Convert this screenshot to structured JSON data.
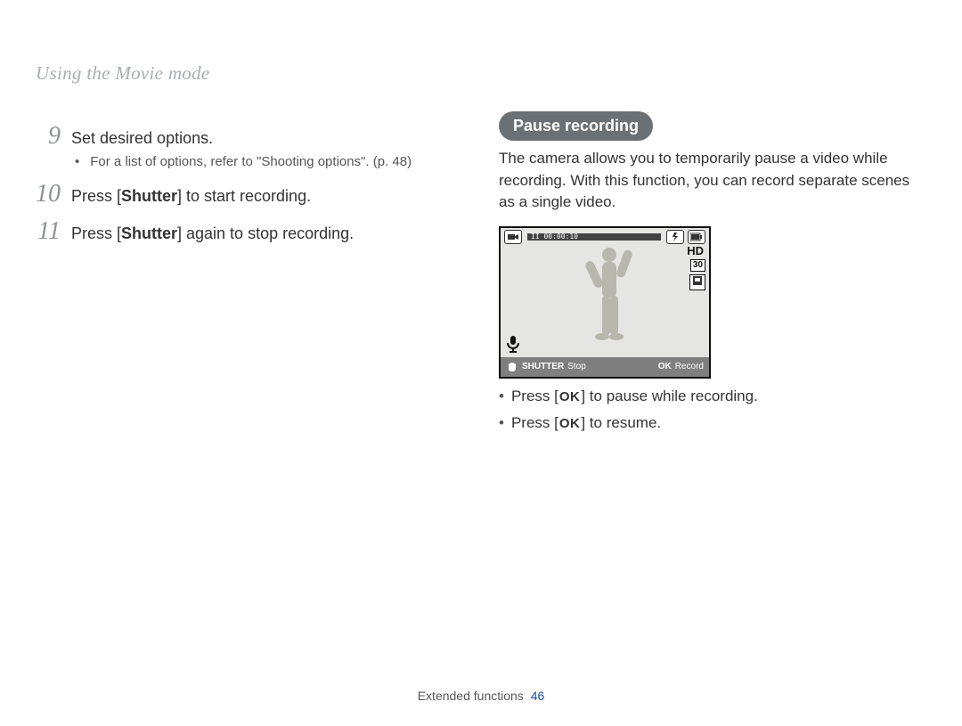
{
  "section_title": "Using the Movie mode",
  "steps": {
    "n9": "9",
    "t9": "Set desired options.",
    "sub9": "For a list of options, refer to \"Shooting options\". (p. 48)",
    "n10": "10",
    "t10_a": "Press [",
    "t10_b": "Shutter",
    "t10_c": "] to start recording.",
    "n11": "11",
    "t11_a": "Press [",
    "t11_b": "Shutter",
    "t11_c": "] again to stop recording."
  },
  "right": {
    "pill": "Pause recording",
    "para": "The camera allows you to temporarily pause a video while recording. With this function, you can record separate scenes as a single video.",
    "b1_a": "Press [",
    "b1_ok": "OK",
    "b1_b": "] to pause while recording.",
    "b2_a": "Press [",
    "b2_ok": "OK",
    "b2_b": "] to resume."
  },
  "lcd": {
    "time": "II  00:00:10",
    "hd": "HD",
    "fps": "30",
    "shutter": "SHUTTER",
    "stop": "Stop",
    "ok": "OK",
    "record": "Record"
  },
  "footer": {
    "label": "Extended functions",
    "page": "46"
  }
}
